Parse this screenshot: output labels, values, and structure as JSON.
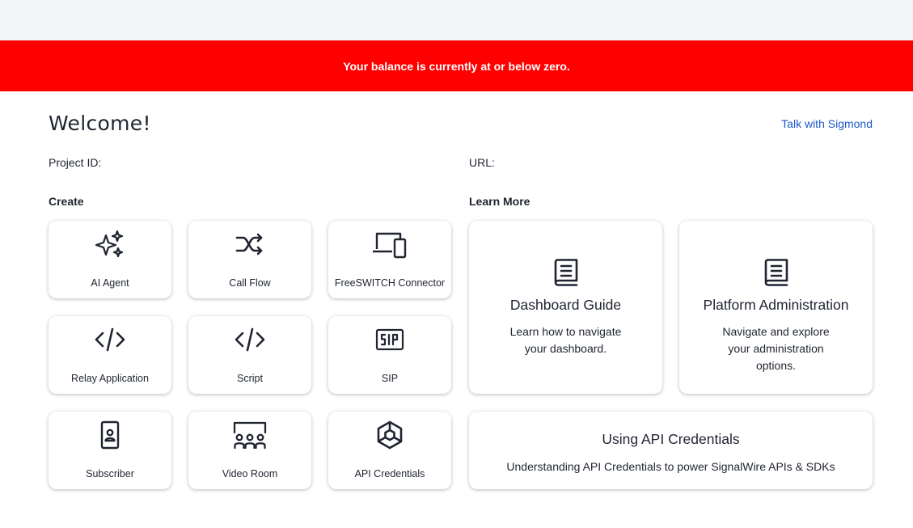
{
  "banner": {
    "text": "Your balance is currently at or below zero.",
    "color": "#ff0000"
  },
  "header": {
    "title": "Welcome!",
    "talk_link": "Talk with Sigmond"
  },
  "project": {
    "id_label": "Project ID:",
    "url_label": "URL:"
  },
  "create": {
    "heading": "Create",
    "tiles": [
      {
        "label": "AI Agent",
        "icon": "sparkles-icon"
      },
      {
        "label": "Call Flow",
        "icon": "shuffle-icon"
      },
      {
        "label": "FreeSWITCH Connector",
        "icon": "devices-icon"
      },
      {
        "label": "Relay Application",
        "icon": "code-icon"
      },
      {
        "label": "Script",
        "icon": "code-icon"
      },
      {
        "label": "SIP",
        "icon": "sip-icon"
      },
      {
        "label": "Subscriber",
        "icon": "id-badge-icon"
      },
      {
        "label": "Video Room",
        "icon": "video-room-icon"
      },
      {
        "label": "API Credentials",
        "icon": "hexagon-icon"
      }
    ]
  },
  "learn": {
    "heading": "Learn More",
    "cards": [
      {
        "title": "Dashboard Guide",
        "description": "Learn how to navigate your dashboard.",
        "icon": "book-icon"
      },
      {
        "title": "Platform Administration",
        "description": "Navigate and explore your administration options.",
        "icon": "book-icon"
      },
      {
        "title": "Using API Credentials",
        "description": "Understanding API Credentials to power SignalWire APIs & SDKs"
      }
    ]
  },
  "colors": {
    "link": "#1b59c9",
    "icon": "#1f2430",
    "page_top": "#f4f5f9"
  }
}
